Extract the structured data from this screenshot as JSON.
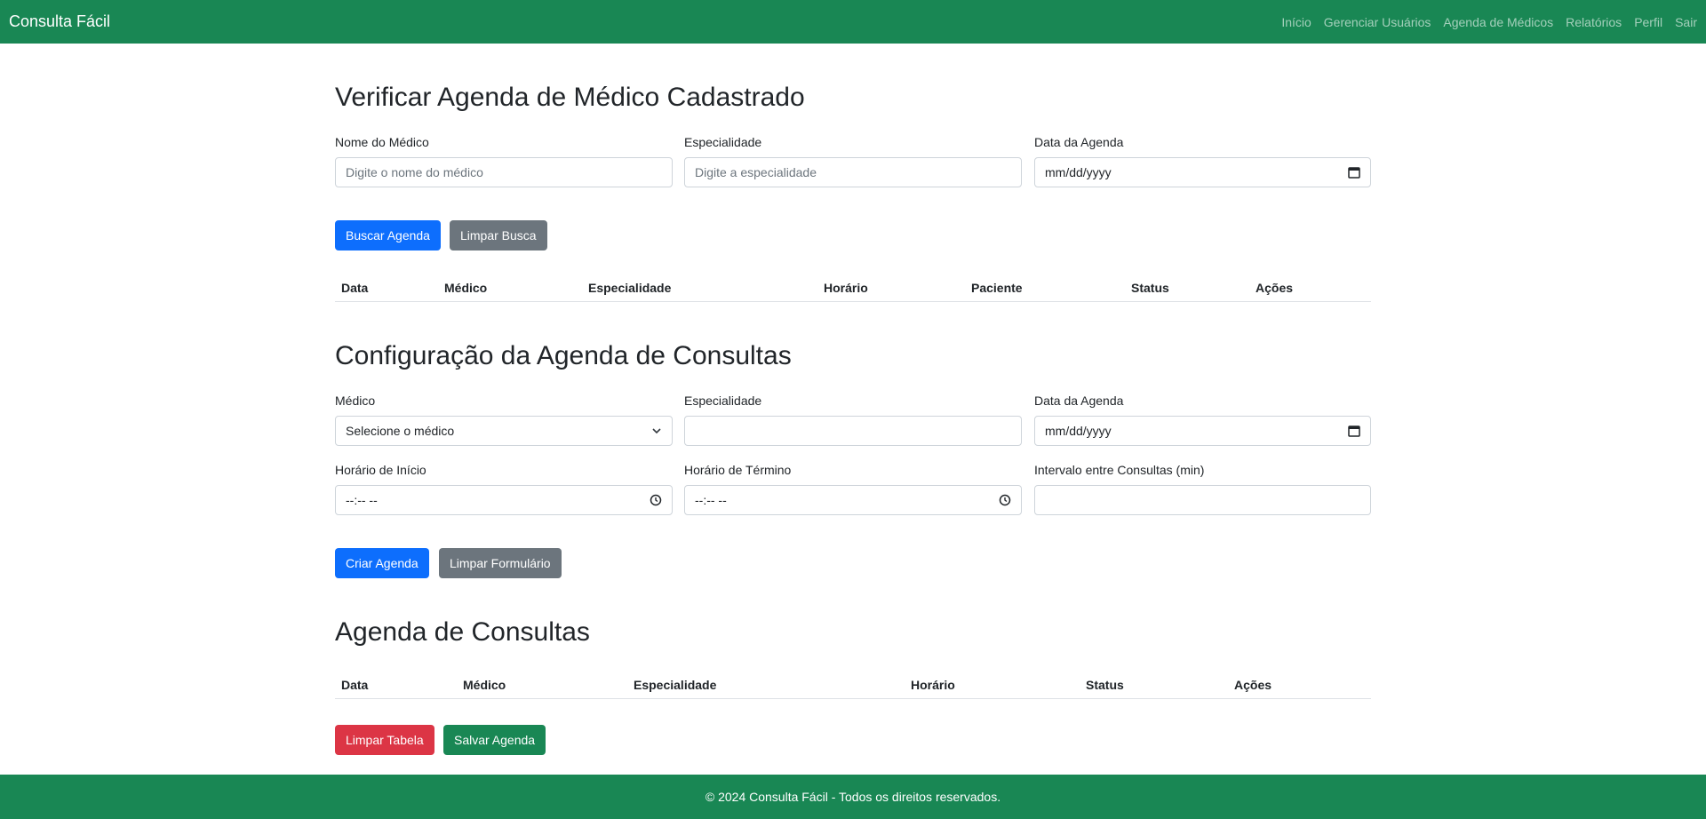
{
  "nav": {
    "brand": "Consulta Fácil",
    "links": [
      "Início",
      "Gerenciar Usuários",
      "Agenda de Médicos",
      "Relatórios",
      "Perfil",
      "Sair"
    ]
  },
  "search_section": {
    "title": "Verificar Agenda de Médico Cadastrado",
    "doctor_label": "Nome do Médico",
    "doctor_placeholder": "Digite o nome do médico",
    "specialty_label": "Especialidade",
    "specialty_placeholder": "Digite a especialidade",
    "date_label": "Data da Agenda",
    "date_value": "mm/dd/yyyy",
    "search_button": "Buscar Agenda",
    "clear_button": "Limpar Busca",
    "table_headers": [
      "Data",
      "Médico",
      "Especialidade",
      "Horário",
      "Paciente",
      "Status",
      "Ações"
    ]
  },
  "config_section": {
    "title": "Configuração da Agenda de Consultas",
    "doctor_label": "Médico",
    "doctor_select_value": "Selecione o médico",
    "specialty_label": "Especialidade",
    "specialty_value": "",
    "date_label": "Data da Agenda",
    "date_value": "mm/dd/yyyy",
    "start_label": "Horário de Início",
    "start_value": "--:-- --",
    "end_label": "Horário de Término",
    "end_value": "--:-- --",
    "interval_label": "Intervalo entre Consultas (min)",
    "interval_value": "",
    "create_button": "Criar Agenda",
    "clear_button": "Limpar Formulário"
  },
  "schedule_section": {
    "title": "Agenda de Consultas",
    "table_headers": [
      "Data",
      "Médico",
      "Especialidade",
      "Horário",
      "Status",
      "Ações"
    ],
    "clear_table_button": "Limpar Tabela",
    "save_button": "Salvar Agenda"
  },
  "footer": {
    "text": "© 2024 Consulta Fácil - Todos os direitos reservados."
  },
  "colors": {
    "brand_green": "#198754",
    "primary_blue": "#0d6efd",
    "secondary_gray": "#6c757d",
    "danger_red": "#dc3545"
  }
}
